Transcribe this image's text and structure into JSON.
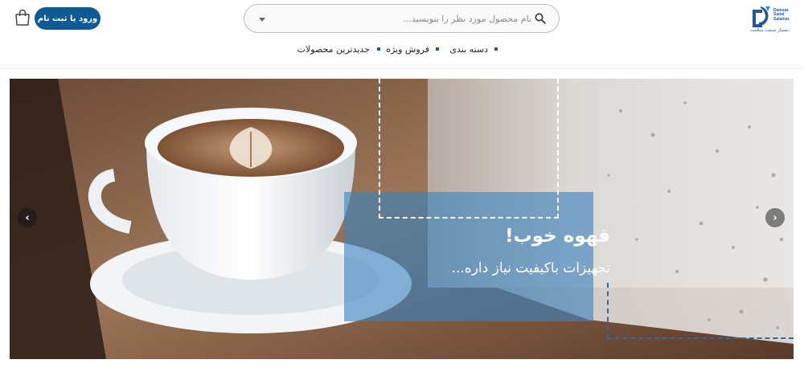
{
  "brand": {
    "logo_lines": [
      "Damsaz",
      "Sanat",
      "Salamat"
    ],
    "logo_subtitle": "دمساز صنعت سلامت",
    "color": "#1f5a96"
  },
  "search": {
    "placeholder": "نام محصول مورد نظر را بنویسید...",
    "icon": "search-icon"
  },
  "account": {
    "login_label": "ورود یا ثبت نام",
    "cart_icon": "shopping-bag-icon",
    "button_color": "#0d5a94"
  },
  "nav": {
    "items": [
      {
        "label": "دسته بندی"
      },
      {
        "label": "فروش ویژه"
      },
      {
        "label": "جدیدترین محصولات"
      }
    ]
  },
  "slider": {
    "headline": "قهوه خوب!",
    "subline": "تجهیزات باکیفیت نیاز داره...",
    "prev_icon": "chevron-left-icon",
    "next_icon": "chevron-right-icon",
    "prev_glyph": "‹",
    "next_glyph": "›",
    "overlay_color": "#3c82be"
  }
}
